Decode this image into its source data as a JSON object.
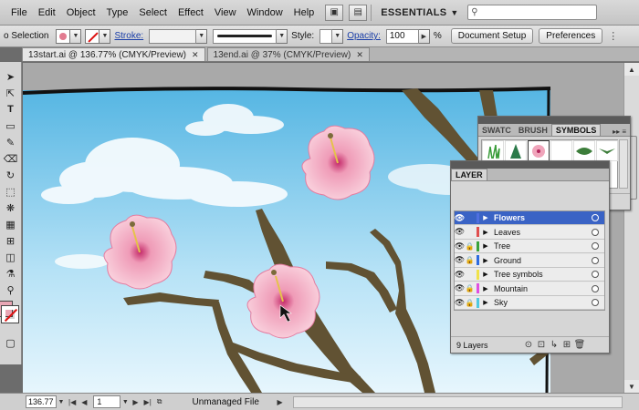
{
  "menubar": {
    "items": [
      "File",
      "Edit",
      "Object",
      "Type",
      "Select",
      "Effect",
      "View",
      "Window",
      "Help"
    ],
    "workspace": "ESSENTIALS"
  },
  "controlbar": {
    "selection_label": "o Selection",
    "stroke_label": "Stroke:",
    "style_label": "Style:",
    "opacity_label": "Opacity:",
    "opacity_value": "100",
    "opacity_unit": "%",
    "document_setup": "Document Setup",
    "preferences": "Preferences"
  },
  "tabs": [
    {
      "label": "13start.ai @ 136.77% (CMYK/Preview)",
      "close": "✕",
      "active": true
    },
    {
      "label": "13end.ai @ 37% (CMYK/Preview)",
      "close": "✕",
      "active": false
    }
  ],
  "symbols_panel": {
    "tabs": [
      "SWATC",
      "BRUSH",
      "SYMBOLS"
    ],
    "active_tab": "SYMBOLS"
  },
  "layers_panel": {
    "tab": "LAYER",
    "layers": [
      {
        "name": "Flowers",
        "color": "#4f6fe0",
        "selected": true,
        "locked": false
      },
      {
        "name": "Leaves",
        "color": "#e04f4f",
        "selected": false,
        "locked": false
      },
      {
        "name": "Tree",
        "color": "#3aa23a",
        "selected": false,
        "locked": true
      },
      {
        "name": "Ground",
        "color": "#2d6be0",
        "selected": false,
        "locked": true
      },
      {
        "name": "Tree symbols",
        "color": "#f0e24a",
        "selected": false,
        "locked": false
      },
      {
        "name": "Mountain",
        "color": "#e04fe0",
        "selected": false,
        "locked": true
      },
      {
        "name": "Sky",
        "color": "#4fc9e0",
        "selected": false,
        "locked": true
      }
    ],
    "count": "9 Layers"
  },
  "statusbar": {
    "zoom": "136.77",
    "page": "1",
    "status": "Unmanaged File"
  }
}
